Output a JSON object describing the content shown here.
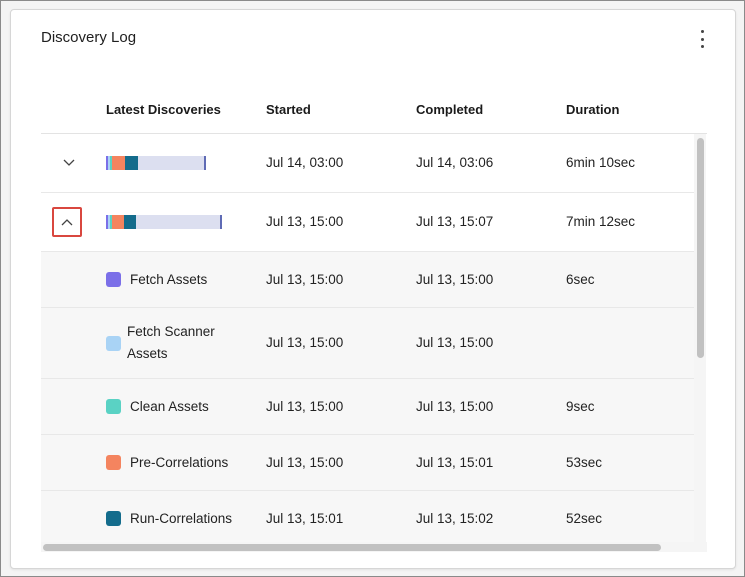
{
  "card": {
    "title": "Discovery Log"
  },
  "table": {
    "headers": {
      "name": "Latest Discoveries",
      "started": "Started",
      "completed": "Completed",
      "duration": "Duration"
    },
    "runs": [
      {
        "expanded": false,
        "chevron_icon": "chevron-down-icon",
        "started": "Jul 14, 03:00",
        "completed": "Jul 14, 03:06",
        "duration": "6min 10sec"
      },
      {
        "expanded": true,
        "chevron_icon": "chevron-up-icon",
        "started": "Jul 13, 15:00",
        "completed": "Jul 13, 15:07",
        "duration": "7min 12sec"
      }
    ],
    "steps": [
      {
        "label": "Fetch Assets",
        "color": "#7b6fe8",
        "started": "Jul 13, 15:00",
        "completed": "Jul 13, 15:00",
        "duration": "6sec"
      },
      {
        "label_line1": "Fetch Scanner",
        "label_line2": "Assets",
        "color": "#a9d3f5",
        "started": "Jul 13, 15:00",
        "completed": "Jul 13, 15:00",
        "duration": ""
      },
      {
        "label": "Clean Assets",
        "color": "#5ad2c4",
        "started": "Jul 13, 15:00",
        "completed": "Jul 13, 15:00",
        "duration": "9sec"
      },
      {
        "label": "Pre-Correlations",
        "color": "#f4845f",
        "started": "Jul 13, 15:00",
        "completed": "Jul 13, 15:01",
        "duration": "53sec"
      },
      {
        "label": "Run-Correlations",
        "color": "#146c8c",
        "started": "Jul 13, 15:01",
        "completed": "Jul 13, 15:02",
        "duration": "52sec"
      }
    ]
  },
  "colors": {
    "highlight_border": "#d9473f",
    "progress_rest": "#dcdff0",
    "progress_end": "#5f6bb5"
  },
  "icons": {
    "menu": "kebab-menu-icon"
  }
}
